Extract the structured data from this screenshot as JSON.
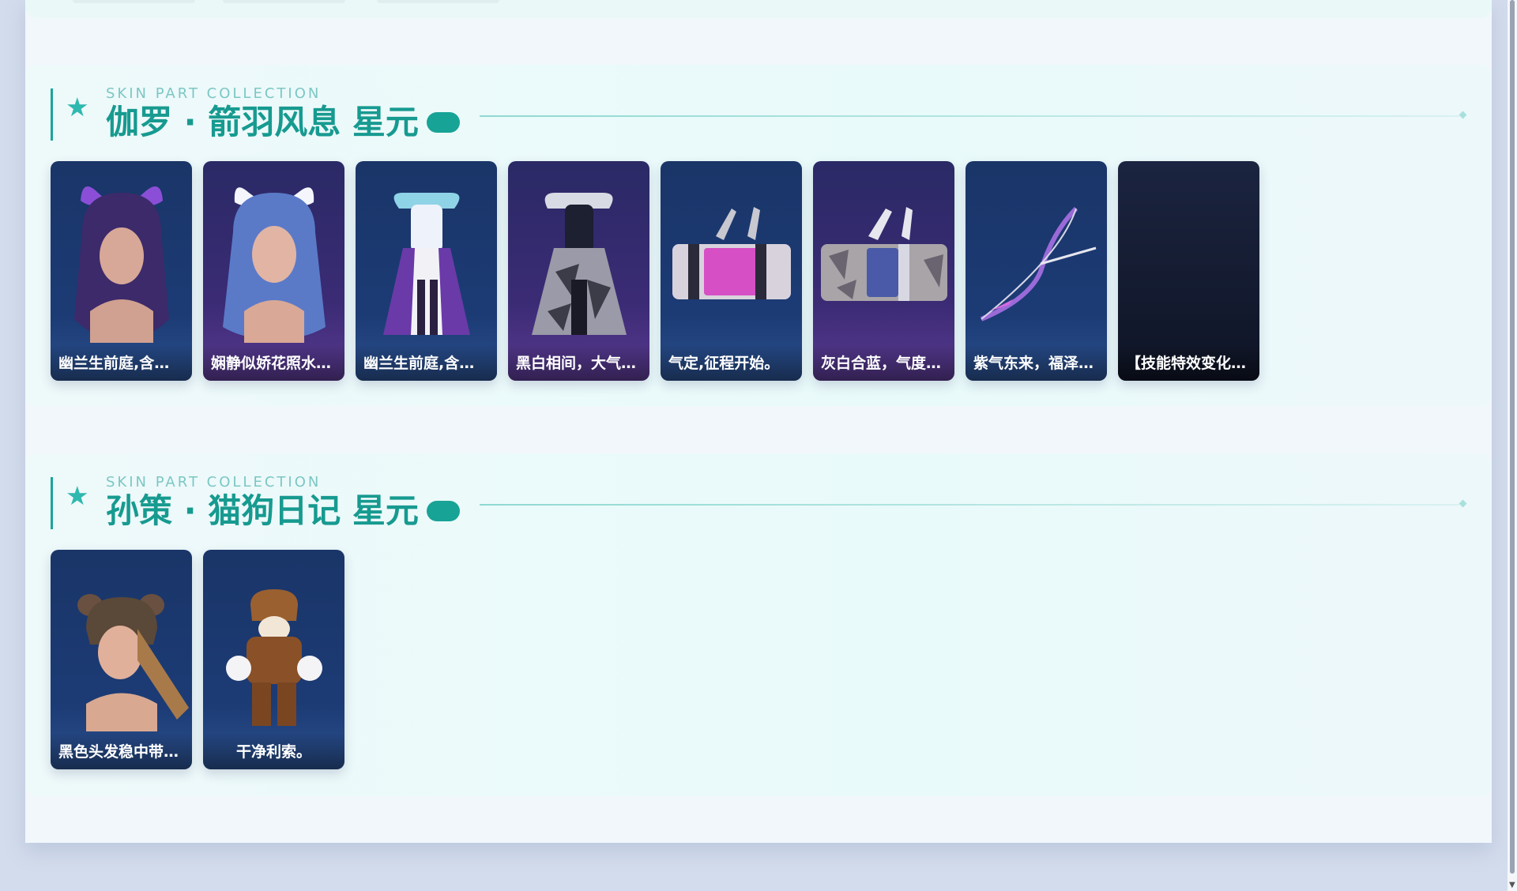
{
  "sections": [
    {
      "subtitle": "SKIN PART COLLECTION",
      "title": "伽罗 · 箭羽风息 星元",
      "items": [
        {
          "label": "幽兰生前庭,含…",
          "art": "hair-purple"
        },
        {
          "label": "娴静似娇花照水…",
          "art": "hair-blue"
        },
        {
          "label": "幽兰生前庭,含…",
          "art": "outfit-purple"
        },
        {
          "label": "黑白相间，大气…",
          "art": "outfit-camo"
        },
        {
          "label": "气定,征程开始。",
          "art": "quiver-pink"
        },
        {
          "label": "灰白合蓝，气度…",
          "art": "quiver-camo"
        },
        {
          "label": "紫气东来，福泽…",
          "art": "bow-purple"
        },
        {
          "label": "【技能特效变化…",
          "art": "skill-effect"
        }
      ]
    },
    {
      "subtitle": "SKIN PART COLLECTION",
      "title": "孙策 · 猫狗日记 星元",
      "items": [
        {
          "label": "黑色头发稳中带…",
          "art": "head-brown"
        },
        {
          "label": "干净利索。",
          "art": "outfit-brown"
        }
      ]
    }
  ],
  "colors": {
    "accent": "#179a90",
    "subtitle": "#7cc7c4",
    "pill": "#17a396"
  }
}
